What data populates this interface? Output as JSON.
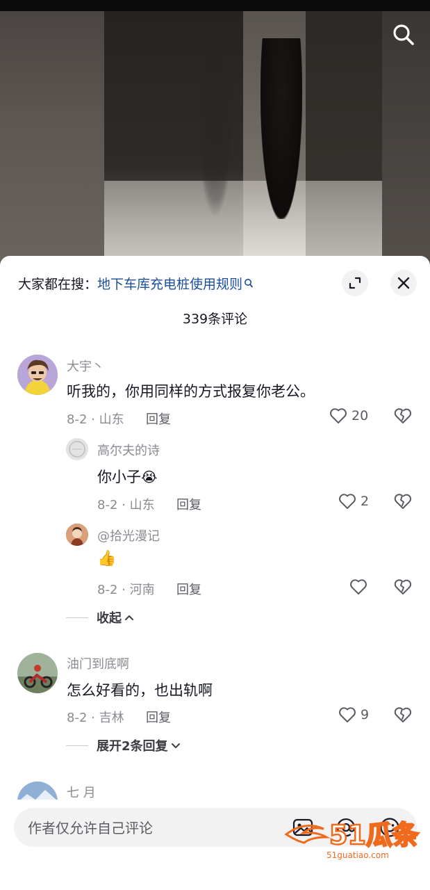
{
  "header": {
    "hot_search_prefix": "大家都在搜：",
    "hot_search_term": "地下车库充电桩使用规则",
    "comment_count": "339条评论"
  },
  "icons": {
    "search": "search-icon",
    "expand": "expand-icon",
    "close": "close-icon",
    "heart": "heart-icon",
    "dislike": "broken-heart-icon",
    "image": "image-icon",
    "mention": "at-icon",
    "emoji": "smiley-icon"
  },
  "comments": [
    {
      "user": "大宇丶",
      "text": "听我的，你用同样的方式报复你老公。",
      "meta": "8-2 · 山东",
      "reply": "回复",
      "likes": "20",
      "replies": [
        {
          "user": "高尔夫的诗",
          "text": "你小子",
          "emoji": "😭",
          "meta": "8-2 · 山东",
          "reply": "回复",
          "likes": "2"
        },
        {
          "user": "@拾光漫记",
          "text": "",
          "emoji": "👍",
          "meta": "8-2 · 河南",
          "reply": "回复",
          "likes": ""
        }
      ],
      "toggle": "收起"
    },
    {
      "user": "油门到底啊",
      "text": "怎么好看的，也出轨啊",
      "meta": "8-2 · 吉林",
      "reply": "回复",
      "likes": "9",
      "toggle": "展开2条回复"
    },
    {
      "user": "七 月"
    }
  ],
  "input": {
    "placeholder": "作者仅允许自己评论"
  },
  "watermark": {
    "text": "51瓜条",
    "url_text": "51guatiao.com"
  },
  "colors": {
    "link_blue": "#1a4f9c",
    "muted": "#8a8b91",
    "watermark_orange": "#f06a1e"
  }
}
